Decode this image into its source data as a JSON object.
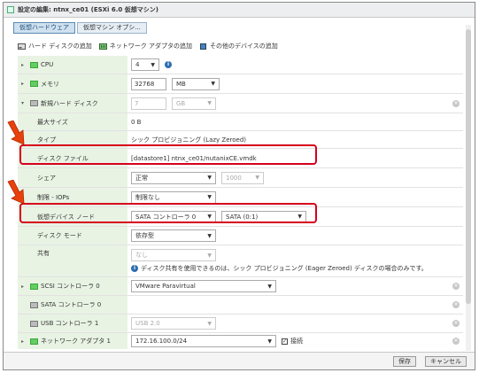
{
  "title": "設定の編集: ntnx_ce01 (ESXi 6.0 仮想マシン)",
  "tabs": [
    {
      "label": "仮想ハードウェア",
      "active": true
    },
    {
      "label": "仮想マシン オプシ..."
    }
  ],
  "toolbar": {
    "add_disk": "ハード ディスクの追加",
    "add_nic": "ネットワーク アダプタの追加",
    "add_other": "その他のデバイスの追加"
  },
  "rows": {
    "cpu": {
      "label": "CPU",
      "value": "4"
    },
    "memory": {
      "label": "メモリ",
      "value": "32768",
      "unit": "MB"
    },
    "new_disk": {
      "label": "新規ハード ディスク",
      "value": "7",
      "unit": "GB"
    },
    "max_size": {
      "label": "最大サイズ",
      "value": "0 B"
    },
    "type": {
      "label": "タイプ",
      "value": "シック プロビジョニング (Lazy Zeroed)"
    },
    "disk_file": {
      "label": "ディスク ファイル",
      "value": "[datastore1] ntnx_ce01/nutanixCE.vmdk"
    },
    "share": {
      "label": "シェア",
      "value": "正常",
      "value2": "1000"
    },
    "limit_iops": {
      "label": "制限 - IOPs",
      "value": "制限なし"
    },
    "vdev_node": {
      "label": "仮想デバイス ノード",
      "controller": "SATA コントローラ 0",
      "port": "SATA (0:1)"
    },
    "disk_mode": {
      "label": "ディスク モード",
      "value": "依存型"
    },
    "sharing": {
      "label": "共有",
      "value": "なし",
      "info": "ディスク共有を使用できるのは、シック プロビジョニング (Eager Zeroed) ディスクの場合のみです。"
    },
    "scsi": {
      "label": "SCSI コントローラ 0",
      "value": "VMware Paravirtual"
    },
    "sata": {
      "label": "SATA コントローラ 0"
    },
    "usb": {
      "label": "USB コントローラ 1",
      "value": "USB 2.0"
    },
    "nic": {
      "label": "ネットワーク アダプタ 1",
      "value": "172.16.100.0/24",
      "connect": "接続"
    }
  },
  "footer": {
    "save": "保存",
    "cancel": "キャンセル"
  },
  "colors": {
    "highlight": "#d6001c",
    "arrow": "#e8400c",
    "label_bg": "#e9f3e4"
  }
}
